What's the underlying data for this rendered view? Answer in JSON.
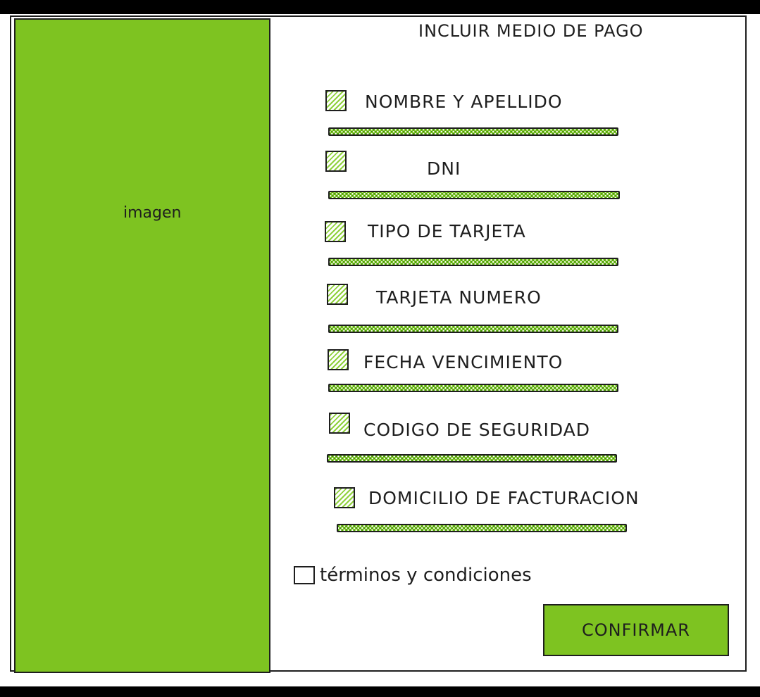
{
  "image_panel": {
    "label": "imagen",
    "color": "#7ec321"
  },
  "form": {
    "title": "INCLUIR MEDIO DE PAGO",
    "fields": [
      {
        "label": "NOMBRE Y APELLIDO"
      },
      {
        "label": "DNI"
      },
      {
        "label": "TIPO DE TARJETA"
      },
      {
        "label": "TARJETA NUMERO"
      },
      {
        "label": "FECHA VENCIMIENTO"
      },
      {
        "label": "CODIGO DE SEGURIDAD"
      },
      {
        "label": "DOMICILIO DE FACTURACION"
      }
    ],
    "terms_label": "términos y condiciones",
    "confirm_label": "CONFIRMAR"
  },
  "colors": {
    "accent_green": "#7ec321",
    "stroke": "#1e1e1e",
    "background": "#ffffff"
  }
}
